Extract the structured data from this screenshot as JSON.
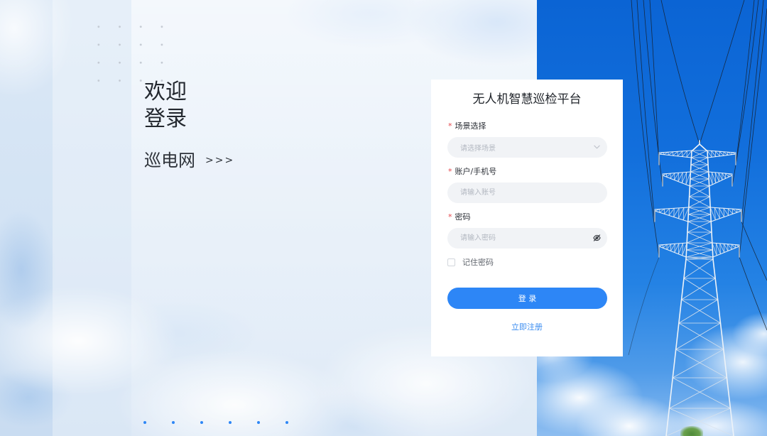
{
  "welcome": {
    "line1": "欢迎",
    "line2": "登录",
    "brand": "巡电网",
    "arrows": ">>>"
  },
  "login": {
    "title": "无人机智慧巡检平台",
    "required_mark": "*",
    "scene": {
      "label": "场景选择",
      "placeholder": "请选择场景",
      "icon": "chevron-down-icon"
    },
    "account": {
      "label": "账户/手机号",
      "placeholder": "请输入账号"
    },
    "password": {
      "label": "密码",
      "placeholder": "请输入密码",
      "icon": "eye-off-icon"
    },
    "remember": {
      "label": "记住密码",
      "checked": false
    },
    "submit_label": "登 录",
    "register_label": "立即注册"
  },
  "colors": {
    "primary": "#2d86f6",
    "link": "#3a8cf0",
    "required": "#e5484d",
    "input_bg": "#f1f3f6",
    "placeholder": "#b3b8c1",
    "title_text": "#1f2329"
  }
}
